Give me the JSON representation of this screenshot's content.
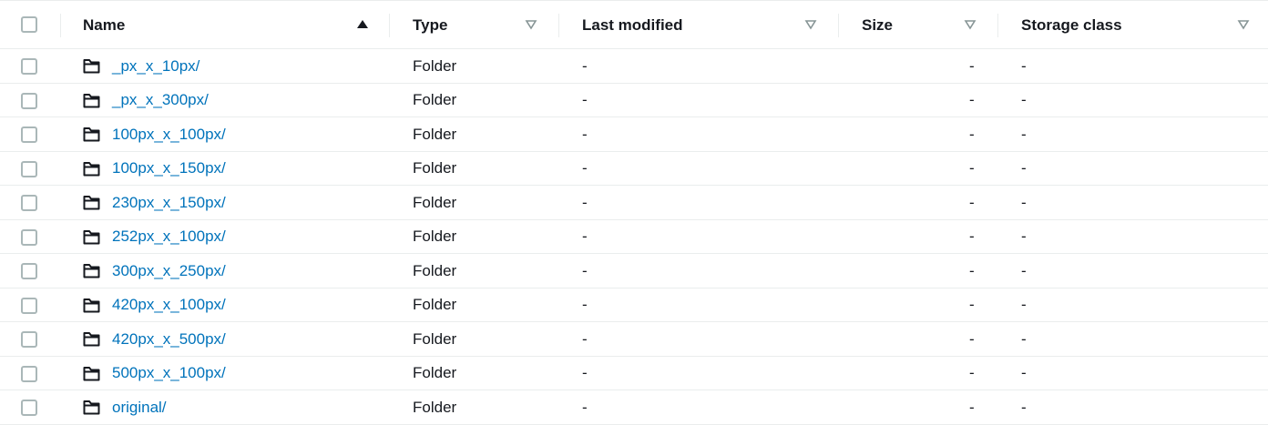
{
  "columns": {
    "name": "Name",
    "type": "Type",
    "last_modified": "Last modified",
    "size": "Size",
    "storage_class": "Storage class"
  },
  "sort": {
    "column": "name",
    "direction": "ascending"
  },
  "rows": [
    {
      "name": "_px_x_10px/",
      "type": "Folder",
      "last_modified": "-",
      "size": "-",
      "storage_class": "-"
    },
    {
      "name": "_px_x_300px/",
      "type": "Folder",
      "last_modified": "-",
      "size": "-",
      "storage_class": "-"
    },
    {
      "name": "100px_x_100px/",
      "type": "Folder",
      "last_modified": "-",
      "size": "-",
      "storage_class": "-"
    },
    {
      "name": "100px_x_150px/",
      "type": "Folder",
      "last_modified": "-",
      "size": "-",
      "storage_class": "-"
    },
    {
      "name": "230px_x_150px/",
      "type": "Folder",
      "last_modified": "-",
      "size": "-",
      "storage_class": "-"
    },
    {
      "name": "252px_x_100px/",
      "type": "Folder",
      "last_modified": "-",
      "size": "-",
      "storage_class": "-"
    },
    {
      "name": "300px_x_250px/",
      "type": "Folder",
      "last_modified": "-",
      "size": "-",
      "storage_class": "-"
    },
    {
      "name": "420px_x_100px/",
      "type": "Folder",
      "last_modified": "-",
      "size": "-",
      "storage_class": "-"
    },
    {
      "name": "420px_x_500px/",
      "type": "Folder",
      "last_modified": "-",
      "size": "-",
      "storage_class": "-"
    },
    {
      "name": "500px_x_100px/",
      "type": "Folder",
      "last_modified": "-",
      "size": "-",
      "storage_class": "-"
    },
    {
      "name": "original/",
      "type": "Folder",
      "last_modified": "-",
      "size": "-",
      "storage_class": "-"
    }
  ],
  "icons": {
    "folder": "folder-icon",
    "sort_active": "sort-ascending-icon",
    "sort_inactive": "sort-icon"
  },
  "colors": {
    "link": "#0073bb",
    "text": "#16191f",
    "border": "#eaeded",
    "sort_inactive": "#879596"
  }
}
